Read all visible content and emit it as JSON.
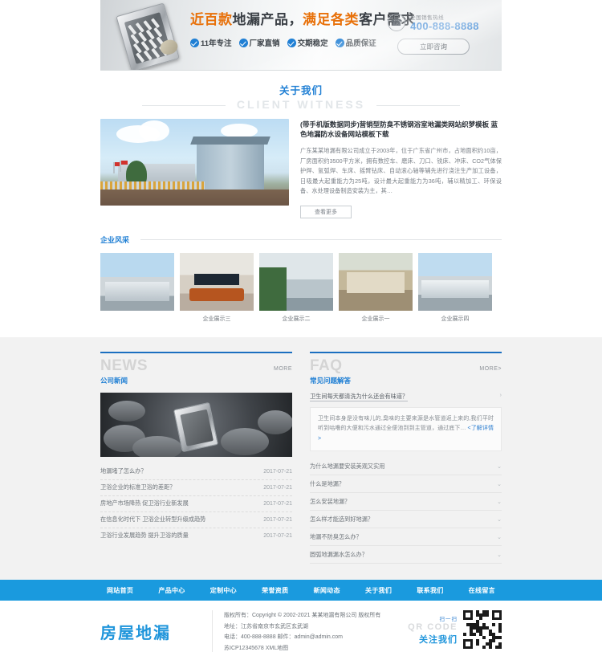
{
  "banner": {
    "headline_parts": [
      {
        "text": "近百款",
        "highlight": true
      },
      {
        "text": "地漏产品，",
        "highlight": false
      },
      {
        "text": "满足各类",
        "highlight": true
      },
      {
        "text": "客户需求",
        "highlight": false
      }
    ],
    "headline_plain": "近百款地漏产品，满足各类客户需求",
    "badges": [
      "11年专注",
      "厂家直销",
      "交期稳定",
      "品质保证"
    ],
    "tel_label": "全国销售热线",
    "tel_number": "400-888-8888",
    "consult_button": "立即咨询",
    "phone_icon": "phone-icon",
    "product_icon": "floor-drain-product-image"
  },
  "about": {
    "title_cn": "关于我们",
    "title_en": "CLIENT WITNESS",
    "image_alt": "factory-building-photo",
    "heading": "(带手机版数据同步)营销型防臭不锈钢浴室地漏类网站织梦模板 蓝色地漏防水设备网站模板下载",
    "body": "广东某某地漏有限公司成立于2003年，位于广东省广州市，占地面积约10亩，厂房面积约3500平方米，拥有数控车、磨床、刀口、铣床、冲床、CO2气体保护焊、氩弧焊、车床、摇臂钻床、自动滚心轴等辅先进行浇注生产加工设备，日吸最大起重能力为25吨，设计最大起重能力为36吨，辅以精加工、环保设备、水处理设备制造安装为主，其…",
    "button": "查看更多"
  },
  "gallery": {
    "title": "企业风采",
    "items": [
      {
        "caption": "",
        "alt": "factory-exterior-photo"
      },
      {
        "caption": "企业展示三",
        "alt": "meeting-room-photo"
      },
      {
        "caption": "企业展示二",
        "alt": "office-building-photo"
      },
      {
        "caption": "企业展示一",
        "alt": "workshop-photo"
      },
      {
        "caption": "企业展示四",
        "alt": "plant-photo"
      }
    ]
  },
  "news": {
    "en": "NEWS",
    "cn": "公司新闻",
    "more": "MORE",
    "feature_image_alt": "floor-drain-on-stones-photo",
    "items": [
      {
        "title": "地漏堵了怎么办？",
        "date": "2017-07-21"
      },
      {
        "title": "卫浴企业的标准卫浴的差距？",
        "date": "2017-07-21"
      },
      {
        "title": "房地产市场降热 促卫浴行业新发展",
        "date": "2017-07-21"
      },
      {
        "title": "在信息化时代下 卫浴企业转型升级成趋势",
        "date": "2017-07-21"
      },
      {
        "title": "卫浴行业发展趋势 提升卫浴的质量",
        "date": "2017-07-21"
      }
    ]
  },
  "faq": {
    "en": "FAQ",
    "cn": "常见问题解答",
    "more": "MORE>",
    "featured_question": "卫生间每天都清洗为什么还会有味道？",
    "featured_answer": "卫生间本身是没有味儿的,臭味的主要来源是水管道返上来的,我们平时听到咕噜的大便和污水通过全便池到到主管道，通过底下…",
    "featured_link": "<了解详情>",
    "items": [
      "为什么地漏要安装美观又实用",
      "什么是地漏？",
      "怎么安装地漏？",
      "怎么样才能选到好地漏？",
      "地漏不防臭怎么办？",
      "圆弧地漏漏水怎么办？"
    ],
    "chevron_icon": "chevron-down-icon"
  },
  "footer_nav": [
    "网站首页",
    "产品中心",
    "定制中心",
    "荣誉资质",
    "新闻动态",
    "关于我们",
    "联系我们",
    "在线留言"
  ],
  "footer": {
    "logo_text": "房屋地漏",
    "copyright": "版权所有：Copyright © 2002-2021 某某地漏有限公司 版权所有",
    "address": "地址：江苏省南京市玄武区玄武湖",
    "contact": "电话：400-888-8888        邮件：admin@admin.com",
    "icp": "苏ICP12345678 XML地图",
    "qr_scan": "扫一扫",
    "qr_en": "QR CODE",
    "qr_cn": "关注我们",
    "qr_alt": "qr-code-image"
  },
  "colors": {
    "primary_blue": "#1f95db",
    "link_blue": "#1f7fd4",
    "rule_blue": "#1b6fc0",
    "orange": "#e8710a",
    "band_grey": "#f2f2f2"
  }
}
